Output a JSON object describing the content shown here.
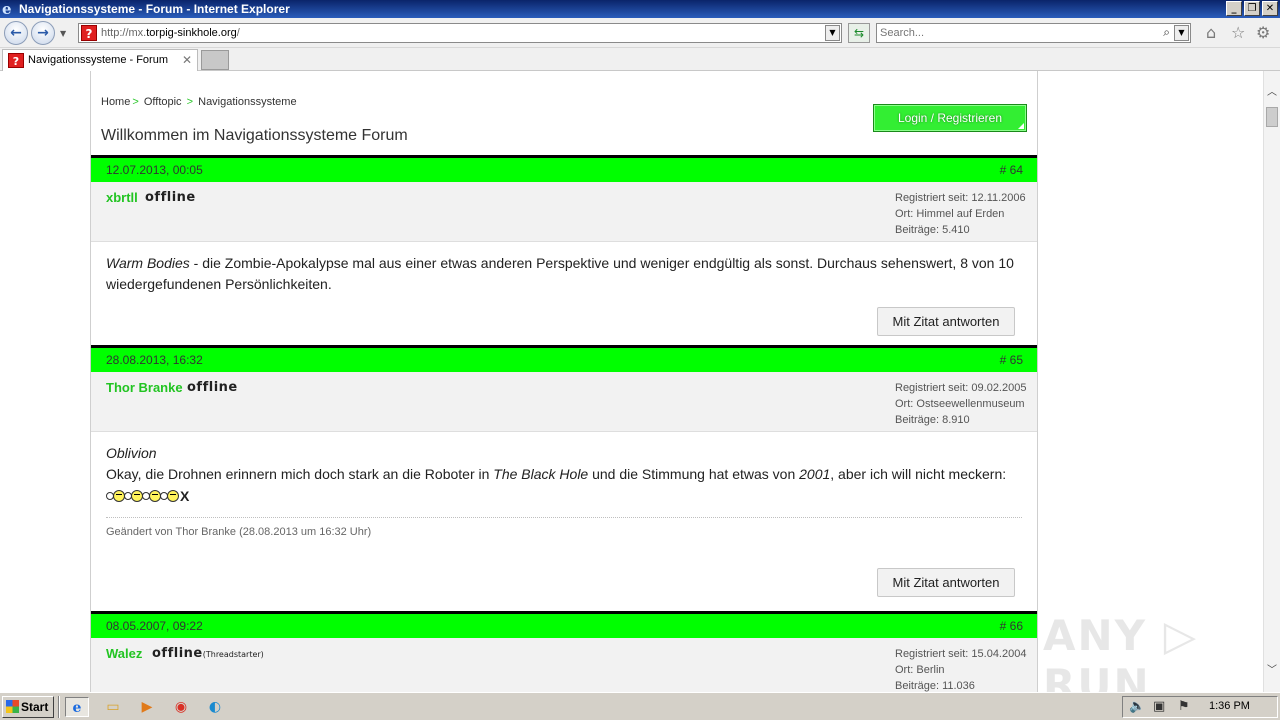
{
  "window": {
    "title": "Navigationssysteme - Forum - Internet Explorer"
  },
  "toolbar": {
    "back_icon": "back-arrow-icon",
    "forward_icon": "forward-arrow-icon",
    "url_prefix": "http://mx.",
    "url_domain": "torpig-sinkhole.org",
    "url_suffix": "/",
    "search_placeholder": "Search..."
  },
  "tabs": [
    {
      "label": "Navigationssysteme - Forum"
    }
  ],
  "page": {
    "breadcrumb": [
      "Home",
      "Offtopic",
      "Navigationssysteme"
    ],
    "breadcrumb_sep": ">",
    "title": "Willkommen im Navigationssysteme Forum",
    "login_label": "Login / Registrieren"
  },
  "posts": [
    {
      "date": "12.07.2013, 00:05",
      "number": "# 64",
      "user": "xbrtll",
      "status": "offline",
      "status_note": "",
      "registered": "Registriert seit: 12.11.2006",
      "location": "Ort: Himmel auf Erden",
      "posts": "Beiträge: 5.410",
      "text_em": "Warm Bodies",
      "text": " - die Zombie-Apokalypse mal aus einer etwas anderen Perspektive und weniger endgültig als sonst. Durchaus sehenswert, 8 von 10 wiedergefundenen Persönlichkeiten.",
      "quote_label": "Mit Zitat antworten"
    },
    {
      "date": "28.08.2013, 16:32",
      "number": "# 65",
      "user": "Thor Branke",
      "status": "offline",
      "status_note": "",
      "registered": "Registriert seit: 09.02.2005",
      "location": "Ort: Ostseewellenmuseum",
      "posts": "Beiträge: 8.910",
      "line1_em": "Oblivion",
      "line2_a": "Okay, die Drohnen erinnern mich doch stark an die Roboter in ",
      "line2_em1": "The Black Hole",
      "line2_b": " und die Stimmung hat etwas von ",
      "line2_em2": "2001",
      "line2_c": ", aber ich will nicht meckern:",
      "smiley_end": "X",
      "edit_note": "Geändert von Thor Branke (28.08.2013 um 16:32 Uhr)",
      "quote_label": "Mit Zitat antworten"
    },
    {
      "date": "08.05.2007, 09:22",
      "number": "# 66",
      "user": "Walez",
      "status": "offline",
      "status_note": "(Threadstarter)",
      "registered": "Registriert seit: 15.04.2004",
      "location": "Ort: Berlin",
      "posts": "Beiträge: 11.036"
    }
  ],
  "watermark": "ANY ▷ RUN",
  "taskbar": {
    "start_label": "Start",
    "clock": "1:36 PM"
  }
}
